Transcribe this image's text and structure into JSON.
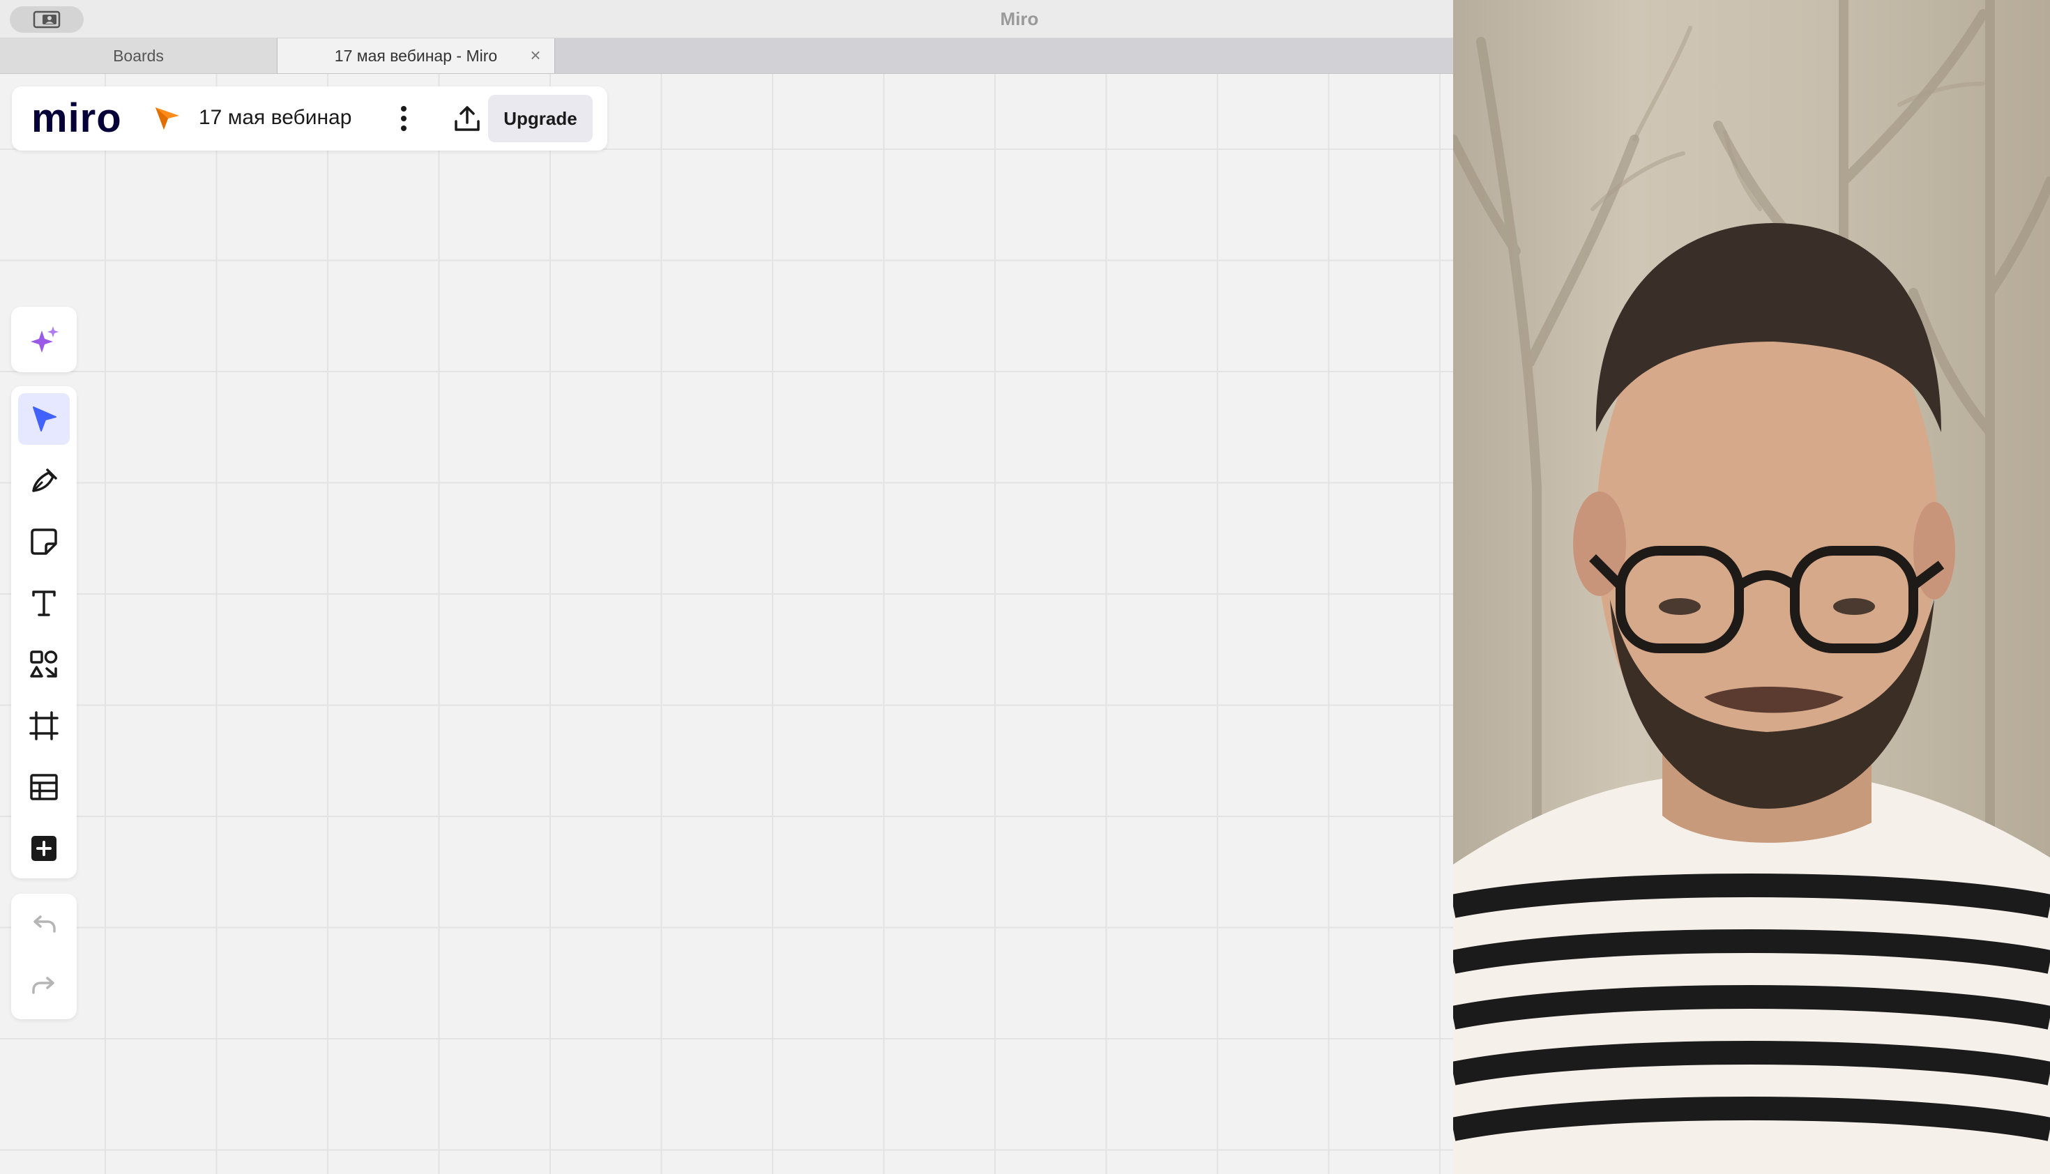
{
  "window": {
    "title": "Miro"
  },
  "tabs": [
    {
      "label": "Boards"
    },
    {
      "label": "17 мая вебинар - Miro",
      "close": "×"
    }
  ],
  "topbar": {
    "logo": "miro",
    "board_name": "17 мая вебинар",
    "upgrade_label": "Upgrade"
  },
  "toolbar": {
    "ai": {
      "icon": "sparkle-icon"
    },
    "tools": [
      {
        "id": "select",
        "icon": "cursor-icon",
        "selected": true
      },
      {
        "id": "pen",
        "icon": "pen-icon"
      },
      {
        "id": "sticky-note",
        "icon": "sticky-note-icon"
      },
      {
        "id": "text",
        "icon": "text-icon"
      },
      {
        "id": "shapes",
        "icon": "shapes-icon"
      },
      {
        "id": "frame",
        "icon": "frame-icon"
      },
      {
        "id": "table",
        "icon": "table-icon"
      },
      {
        "id": "more-apps",
        "icon": "plus-square-icon"
      }
    ],
    "history": [
      {
        "id": "undo",
        "icon": "undo-icon",
        "enabled": false
      },
      {
        "id": "redo",
        "icon": "redo-icon",
        "enabled": false
      }
    ]
  },
  "colors": {
    "accent": "#4262ff",
    "board_icon": "#ff8c1a",
    "ai_purple": "#9b59e8",
    "canvas": "#f2f2f2",
    "grid": "#e3e3e3"
  }
}
